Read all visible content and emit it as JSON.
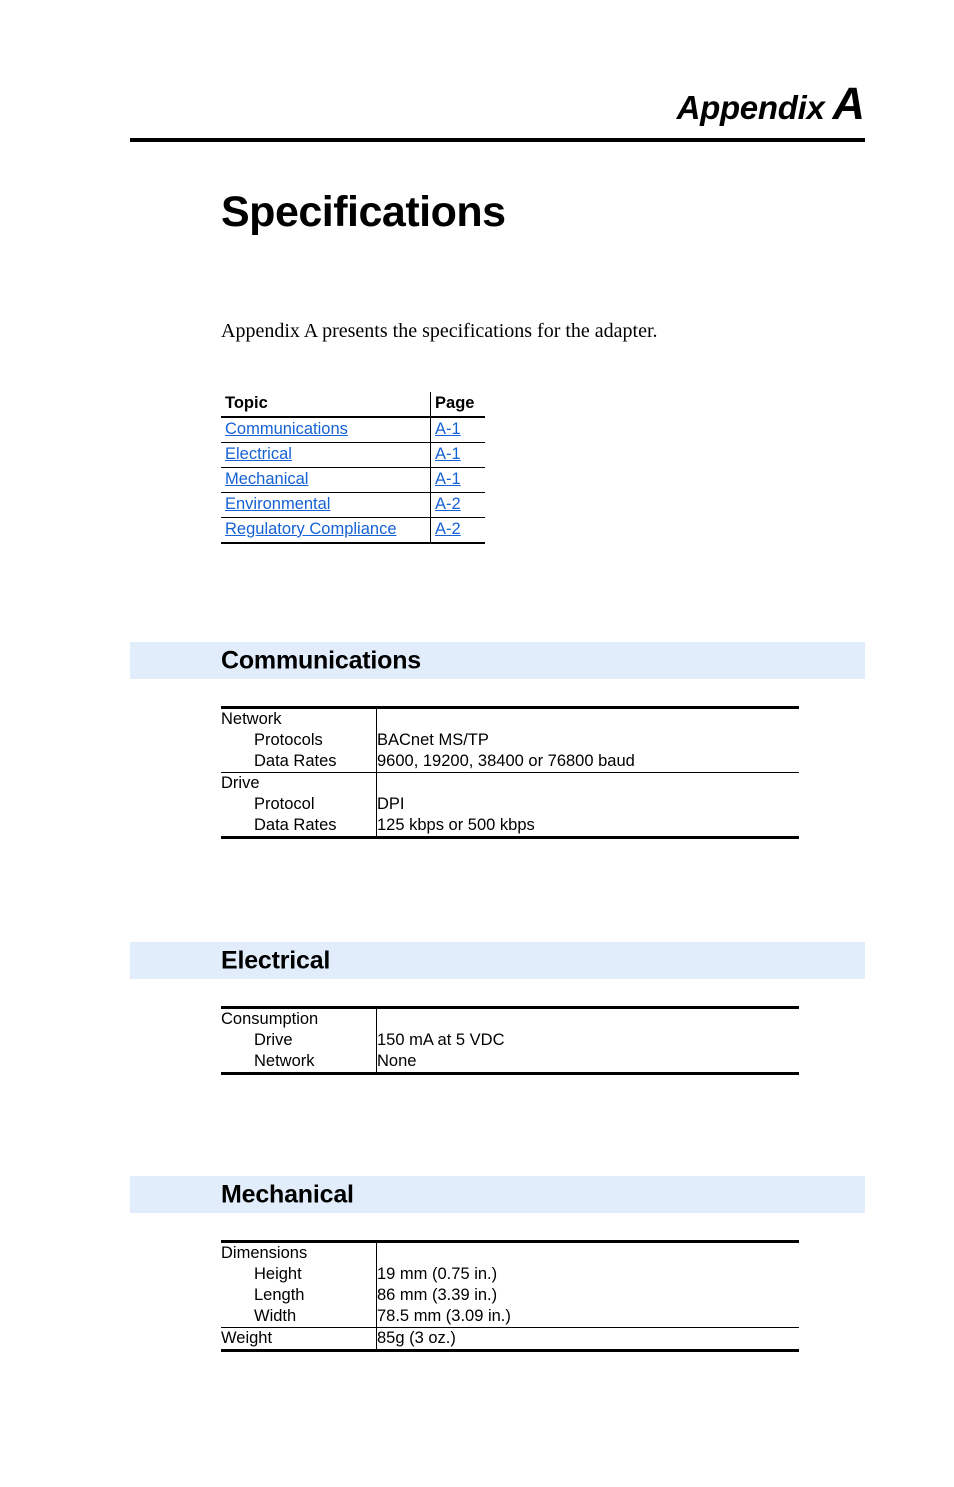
{
  "header": {
    "appendix_word": "Appendix",
    "appendix_letter": "A"
  },
  "title": "Specifications",
  "intro": "Appendix A presents the specifications for the adapter.",
  "toc": {
    "columns": [
      "Topic",
      "Page"
    ],
    "rows": [
      {
        "topic": "Communications",
        "page": "A-1"
      },
      {
        "topic": "Electrical",
        "page": "A-1"
      },
      {
        "topic": "Mechanical",
        "page": "A-1"
      },
      {
        "topic": "Environmental",
        "page": "A-2"
      },
      {
        "topic": "Regulatory Compliance",
        "page": "A-2"
      }
    ]
  },
  "sections": [
    {
      "heading": "Communications",
      "groups": [
        {
          "labels": [
            "Network",
            "Protocols",
            "Data Rates"
          ],
          "values": [
            "",
            "BACnet MS/TP",
            "9600, 19200, 38400 or 76800 baud"
          ]
        },
        {
          "labels": [
            "Drive",
            "Protocol",
            "Data Rates"
          ],
          "values": [
            "",
            "DPI",
            "125 kbps or 500 kbps"
          ]
        }
      ]
    },
    {
      "heading": "Electrical",
      "groups": [
        {
          "labels": [
            "Consumption",
            "Drive",
            "Network"
          ],
          "values": [
            "",
            "150 mA at 5 VDC",
            "None"
          ]
        }
      ]
    },
    {
      "heading": "Mechanical",
      "groups": [
        {
          "labels": [
            "Dimensions",
            "Height",
            "Length",
            "Width"
          ],
          "values": [
            "",
            "19 mm (0.75 in.)",
            "86 mm (3.39 in.)",
            "78.5 mm (3.09 in.)"
          ]
        },
        {
          "labels": [
            "Weight"
          ],
          "values": [
            "85g (3 oz.)"
          ]
        }
      ]
    }
  ],
  "colors": {
    "link": "#1561d6",
    "section_band": "#e2edfc",
    "rule": "#000000"
  }
}
